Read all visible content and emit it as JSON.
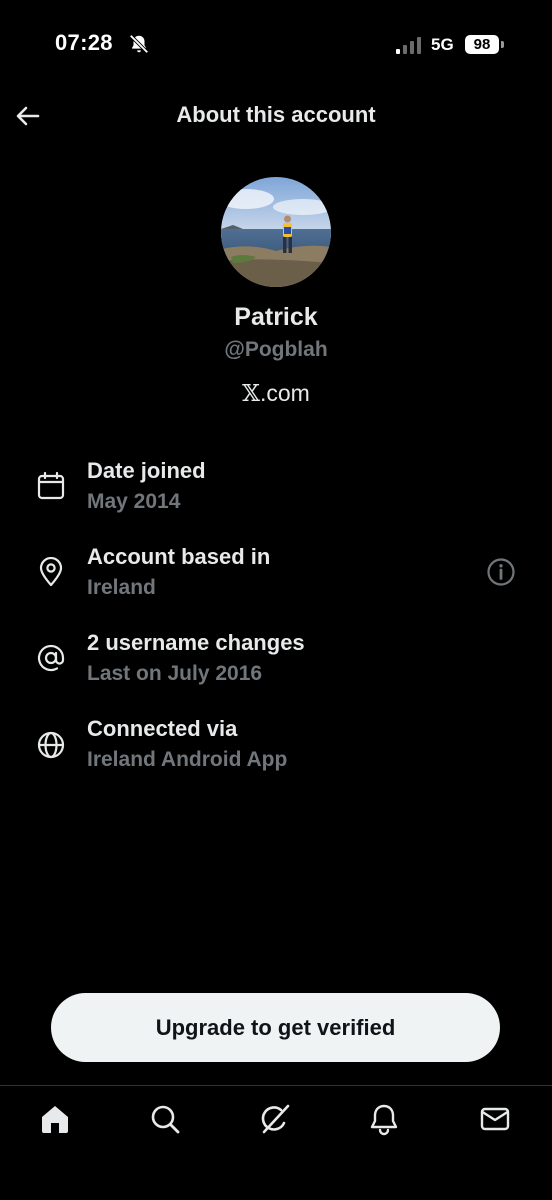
{
  "status_bar": {
    "time": "07:28",
    "network": "5G",
    "battery": "98"
  },
  "header": {
    "title": "About this account"
  },
  "profile": {
    "name": "Patrick",
    "handle": "@Pogblah",
    "site_prefix": "𝕏",
    "site_suffix": ".com"
  },
  "info_rows": [
    {
      "icon": "calendar-icon",
      "title": "Date joined",
      "subtitle": "May 2014"
    },
    {
      "icon": "location-pin-icon",
      "title": "Account based in",
      "subtitle": "Ireland"
    },
    {
      "icon": "at-sign-icon",
      "title": "2 username changes",
      "subtitle": "Last on July 2016"
    },
    {
      "icon": "globe-icon",
      "title": "Connected via",
      "subtitle": "Ireland Android App"
    }
  ],
  "upgrade_button": {
    "label": "Upgrade to get verified"
  },
  "bottom_nav": {
    "items": [
      "home-icon",
      "search-icon",
      "grok-icon",
      "notifications-bell-icon",
      "messages-envelope-icon"
    ]
  },
  "colors": {
    "background": "#000000",
    "primary_text": "#e7e9ea",
    "secondary_text": "#71767b",
    "button_bg": "#eff3f4",
    "divider": "#2f3336"
  }
}
